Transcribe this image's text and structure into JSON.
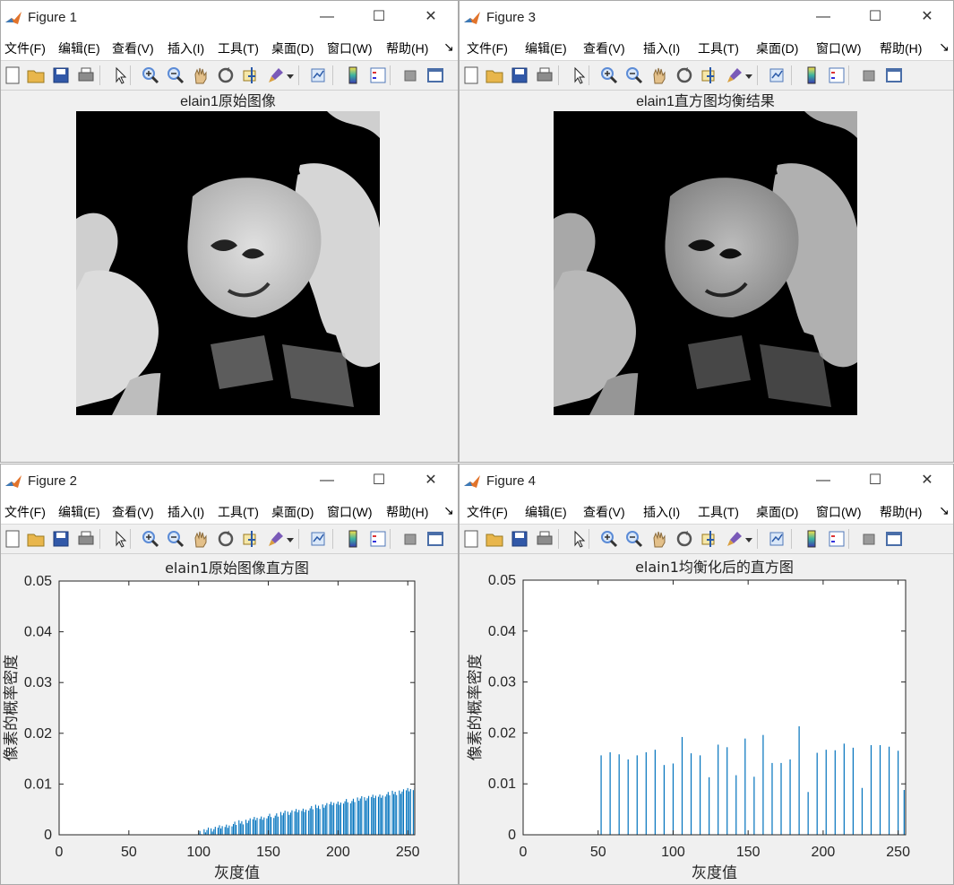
{
  "menu_items": [
    "文件(F)",
    "编辑(E)",
    "查看(V)",
    "插入(I)",
    "工具(T)",
    "桌面(D)",
    "窗口(W)",
    "帮助(H)"
  ],
  "menu_overflow": "↘",
  "window_controls": {
    "minimize": "—",
    "maximize": "☐",
    "close": "✕"
  },
  "toolbar_icons": [
    "new-figure-icon",
    "open-folder-icon",
    "save-icon",
    "print-icon",
    "select-arrow-icon",
    "zoom-in-icon",
    "zoom-out-icon",
    "pan-hand-icon",
    "rotate-3d-icon",
    "data-cursor-icon",
    "brush-icon",
    "link-plot-icon",
    "colorbar-icon",
    "legend-icon",
    "hide-plot-tools-icon",
    "show-plot-tools-icon"
  ],
  "colors": {
    "bar": "#0072bd",
    "window_bg": "#f0f0f0",
    "axes_bg": "#ffffff"
  },
  "figures": {
    "fig1": {
      "title": "Figure 1",
      "axes_title": "elain1原始图像"
    },
    "fig3": {
      "title": "Figure 3",
      "axes_title": "elain1直方图均衡结果"
    },
    "fig2": {
      "title": "Figure 2",
      "axes_title": "elain1原始图像直方图",
      "xlabel": "灰度值",
      "ylabel": "像素的概率密度"
    },
    "fig4": {
      "title": "Figure 4",
      "axes_title": "elain1均衡化后的直方图",
      "xlabel": "灰度值",
      "ylabel": "像素的概率密度"
    }
  },
  "chart_data": [
    {
      "id": "fig2",
      "type": "bar",
      "title": "elain1原始图像直方图",
      "xlabel": "灰度值",
      "ylabel": "像素的概率密度",
      "xlim": [
        0,
        255
      ],
      "ylim": [
        0,
        0.05
      ],
      "xticks": [
        0,
        50,
        100,
        150,
        200,
        250
      ],
      "yticks": [
        0,
        0.01,
        0.02,
        0.03,
        0.04,
        0.05
      ],
      "ytick_labels": [
        "0",
        "0.01",
        "0.02",
        "0.03",
        "0.04",
        "0.05"
      ],
      "trend": {
        "start_x": 98,
        "end_x": 255,
        "start_y": 0.0002,
        "end_y": 0.009
      }
    },
    {
      "id": "fig4",
      "type": "bar",
      "title": "elain1均衡化后的直方图",
      "xlabel": "灰度值",
      "ylabel": "像素的概率密度",
      "xlim": [
        0,
        255
      ],
      "ylim": [
        0,
        0.05
      ],
      "xticks": [
        0,
        50,
        100,
        150,
        200,
        250
      ],
      "yticks": [
        0,
        0.01,
        0.02,
        0.03,
        0.04,
        0.05
      ],
      "ytick_labels": [
        "0",
        "0.01",
        "0.02",
        "0.03",
        "0.04",
        "0.05"
      ],
      "x": [
        52,
        58,
        64,
        70,
        76,
        82,
        88,
        94,
        100,
        106,
        112,
        118,
        124,
        130,
        136,
        142,
        148,
        154,
        160,
        166,
        172,
        178,
        184,
        190,
        196,
        202,
        208,
        214,
        220,
        226,
        232,
        238,
        244,
        250,
        254
      ],
      "values": [
        0.0156,
        0.0162,
        0.0158,
        0.0148,
        0.0156,
        0.0162,
        0.0167,
        0.0137,
        0.014,
        0.0192,
        0.016,
        0.0156,
        0.0113,
        0.0177,
        0.0172,
        0.0117,
        0.0189,
        0.0114,
        0.0196,
        0.0141,
        0.0141,
        0.0148,
        0.0213,
        0.0084,
        0.0161,
        0.0167,
        0.0166,
        0.0179,
        0.0171,
        0.0092,
        0.0176,
        0.0176,
        0.0173,
        0.0165,
        0.0088
      ]
    }
  ]
}
